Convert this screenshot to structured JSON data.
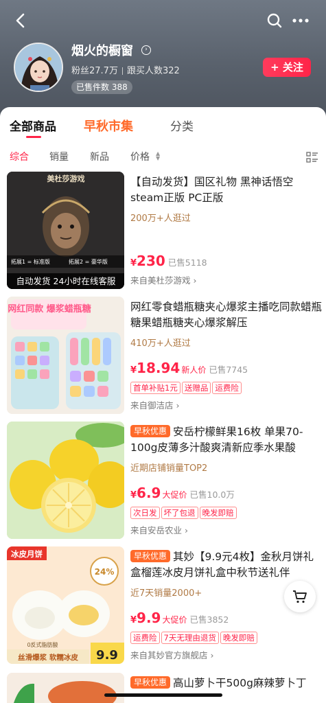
{
  "shop": {
    "name": "烟火的橱窗",
    "fans": "粉丝27.7万",
    "buyers": "跟买人数322",
    "sold_badge": "已售件数 388",
    "follow_label": "+ 关注"
  },
  "tabs": [
    "全部商品",
    "早秋市集",
    "分类"
  ],
  "filters": [
    "综合",
    "销量",
    "新品",
    "价格"
  ],
  "products": [
    {
      "thumb_top": "美杜莎游戏",
      "thumb_bottom": "自动发货 24小时在线客服",
      "thumb_opt1": "拓展1 = 标准版",
      "thumb_opt2": "拓展2 = 豪华版",
      "tag": "",
      "title": "【自动发货】国区礼物 黑神话悟空steam正版 PC正版",
      "subline": "200万+人逛过",
      "price_yen": "¥",
      "price_num": "230",
      "price_label": "",
      "sold": "已售5118",
      "chips": [],
      "from": "来自美杜莎游戏 ›"
    },
    {
      "thumb_top": "网红同款 爆浆蜡瓶糖",
      "thumb_bottom": "",
      "tag": "",
      "title": "网红零食蜡瓶糖夹心爆浆主播吃同款蜡瓶糖果蜡瓶糖夹心爆浆解压",
      "subline": "410万+人逛过",
      "price_yen": "¥",
      "price_num": "18.94",
      "price_label": "新人价",
      "sold": "已售7745",
      "chips": [
        "首单补贴1元",
        "送赠品",
        "运费险"
      ],
      "from": "来自御洁店 ›"
    },
    {
      "thumb_top": "",
      "thumb_bottom": "",
      "tag": "早秋优惠",
      "title": "安岳柠檬鲜果16枚 单果70-100g皮薄多汁酸爽清新应季水果酸",
      "subline": "近期店铺销量TOP2",
      "price_yen": "¥",
      "price_num": "6.9",
      "price_label": "大促价",
      "sold": "已售10.0万",
      "chips": [
        "次日发",
        "坏了包退",
        "晚发即赔"
      ],
      "from": "来自安岳农业 ›"
    },
    {
      "thumb_top": "冰皮月饼",
      "thumb_bottom": "丝滑爆浆 软糯冰皮",
      "thumb_badge": "24%",
      "thumb_price": "9.9",
      "thumb_small": "0反式脂肪酸",
      "tag": "早秋优惠",
      "title": "其妙【9.9元4枚】金秋月饼礼盒榴莲冰皮月饼礼盒中秋节送礼伴",
      "subline": "近7天销量2000+",
      "price_yen": "¥",
      "price_num": "9.9",
      "price_label": "大促价",
      "sold": "已售3852",
      "chips": [
        "运费险",
        "7天无理由退货",
        "晚发即赔"
      ],
      "from": "来自其妙官方旗舰店 ›"
    },
    {
      "tag": "早秋优惠",
      "title": "高山萝卜干500g麻辣萝卜丁"
    }
  ],
  "colors": {
    "accent": "#ff2448",
    "promo": "#ff6a2a"
  }
}
